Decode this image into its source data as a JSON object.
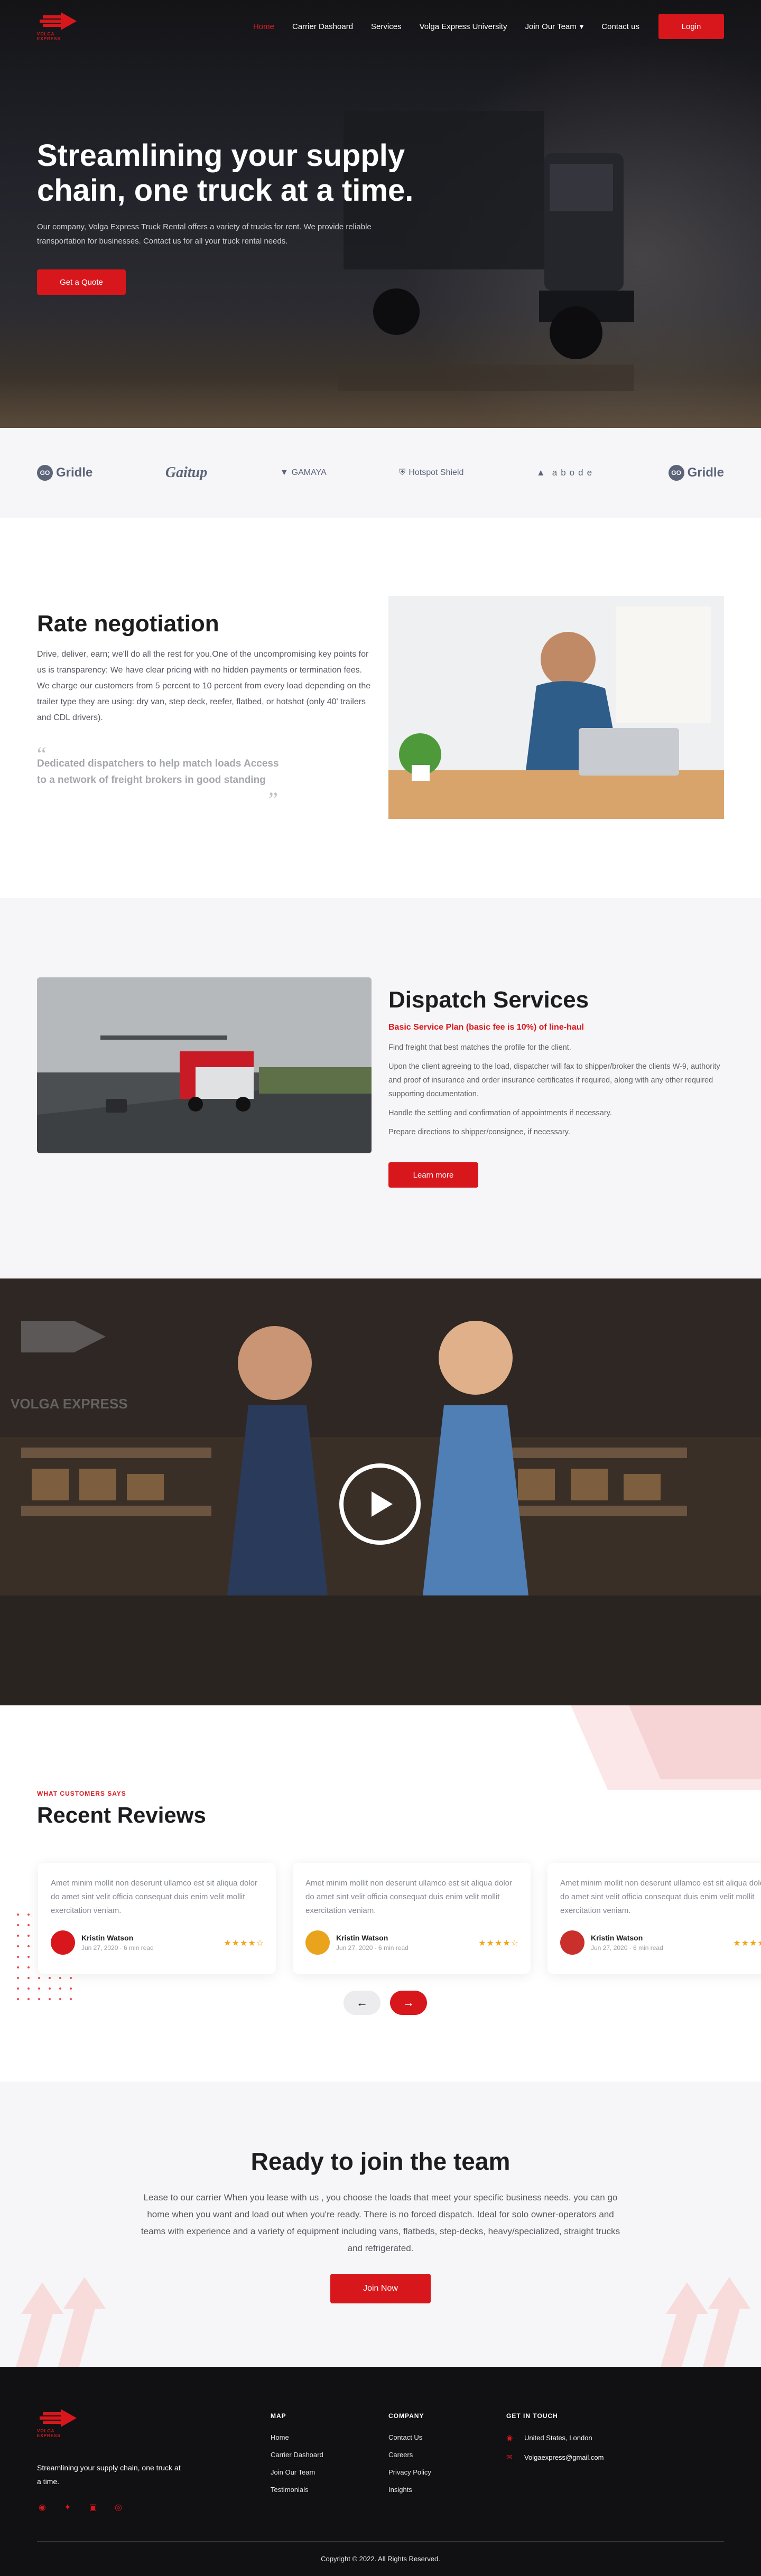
{
  "nav": {
    "logo_text": "VOLGA EXPRESS",
    "items": [
      {
        "label": "Home",
        "active": true
      },
      {
        "label": "Carrier Dashoard",
        "active": false
      },
      {
        "label": "Services",
        "active": false
      },
      {
        "label": "Volga Express University",
        "active": false
      },
      {
        "label": "Join Our Team",
        "active": false
      },
      {
        "label": "Contact us",
        "active": false
      }
    ],
    "login": "Login"
  },
  "hero": {
    "title": "Streamlining your supply chain, one truck at a time.",
    "text": "Our company, Volga Express Truck Rental offers a variety of trucks for rent. We provide reliable transportation for businesses. Contact us for all your truck rental needs.",
    "cta": "Get a Quote"
  },
  "logos": [
    "Gridle",
    "Gaitup",
    "GAMAYA",
    "Hotspot Shield",
    "abode",
    "Gridle"
  ],
  "rate": {
    "title": "Rate negotiation",
    "body": "Drive, deliver, earn; we'll do all the rest for you.One of the uncompromising key points for us is transparency: We have clear pricing with no hidden payments or termination fees. We charge our customers from 5 percent to 10 percent from every load depending on the trailer type they are using: dry van, step deck, reefer, flatbed, or hotshot (only 40' trailers and CDL drivers).",
    "testimonial": "Dedicated dispatchers to help match loads Access to a network of freight brokers in good standing"
  },
  "dispatch": {
    "title": "Dispatch Services",
    "plan": "Basic Service Plan (basic fee is 10%) of line-haul",
    "items": [
      "Find freight that best matches the profile for the client.",
      "Upon the client agreeing to the load, dispatcher will fax to shipper/broker the clients W-9, authority and proof of insurance and order insurance certificates if required, along with any other required supporting documentation.",
      "Handle the settling and confirmation of appointments if necessary.",
      "Prepare directions to shipper/consignee, if necessary."
    ],
    "cta": "Learn more"
  },
  "video": {
    "brand": "VOLGA EXPRESS"
  },
  "reviews": {
    "eyebrow": "WHAT CUSTOMERS SAYS",
    "title": "Recent Reviews",
    "cards": [
      {
        "text": "Amet minim mollit non deserunt ullamco est sit aliqua dolor do amet sint velit officia consequat duis enim velit mollit exercitation veniam.",
        "name": "Kristin Watson",
        "date": "Jun 27, 2020 · 6 min read",
        "avatar": "#d8171c"
      },
      {
        "text": "Amet minim mollit non deserunt ullamco est sit aliqua dolor do amet sint velit officia consequat duis enim velit mollit exercitation veniam.",
        "name": "Kristin Watson",
        "date": "Jun 27, 2020 · 6 min read",
        "avatar": "#e9a31d"
      },
      {
        "text": "Amet minim mollit non deserunt ullamco est sit aliqua dolor do amet sint velit officia consequat duis enim velit mollit exercitation veniam.",
        "name": "Kristin Watson",
        "date": "Jun 27, 2020 · 6 min read",
        "avatar": "#c9302c"
      }
    ],
    "stars": "★★★★☆"
  },
  "join": {
    "title": "Ready to join the team",
    "text": "Lease to our carrier When you lease with us , you choose the loads that meet your specific business needs. you can go home when you want and load out when you're ready. There is no forced dispatch. Ideal for solo owner-operators and teams with experience and a variety of equipment including vans, flatbeds, step-decks, heavy/specialized, straight trucks and refrigerated.",
    "cta": "Join Now"
  },
  "footer": {
    "tagline": "Streamlining your supply chain, one truck at a time.",
    "map_title": "MAP",
    "map_links": [
      "Home",
      "Carrier Dashoard",
      "Join Our Team",
      "Testimonials"
    ],
    "company_title": "COMPANY",
    "company_links": [
      "Contact Us",
      "Careers",
      "Privacy Policy",
      "Insights"
    ],
    "touch_title": "GET IN TOUCH",
    "location": "United States, London",
    "email": "Volgaexpress@gmail.com",
    "copyright": "Copyright © 2022. All Rights Reserved."
  },
  "colors": {
    "accent": "#d8171c",
    "dark": "#111114",
    "light_bg": "#f6f6f8"
  }
}
